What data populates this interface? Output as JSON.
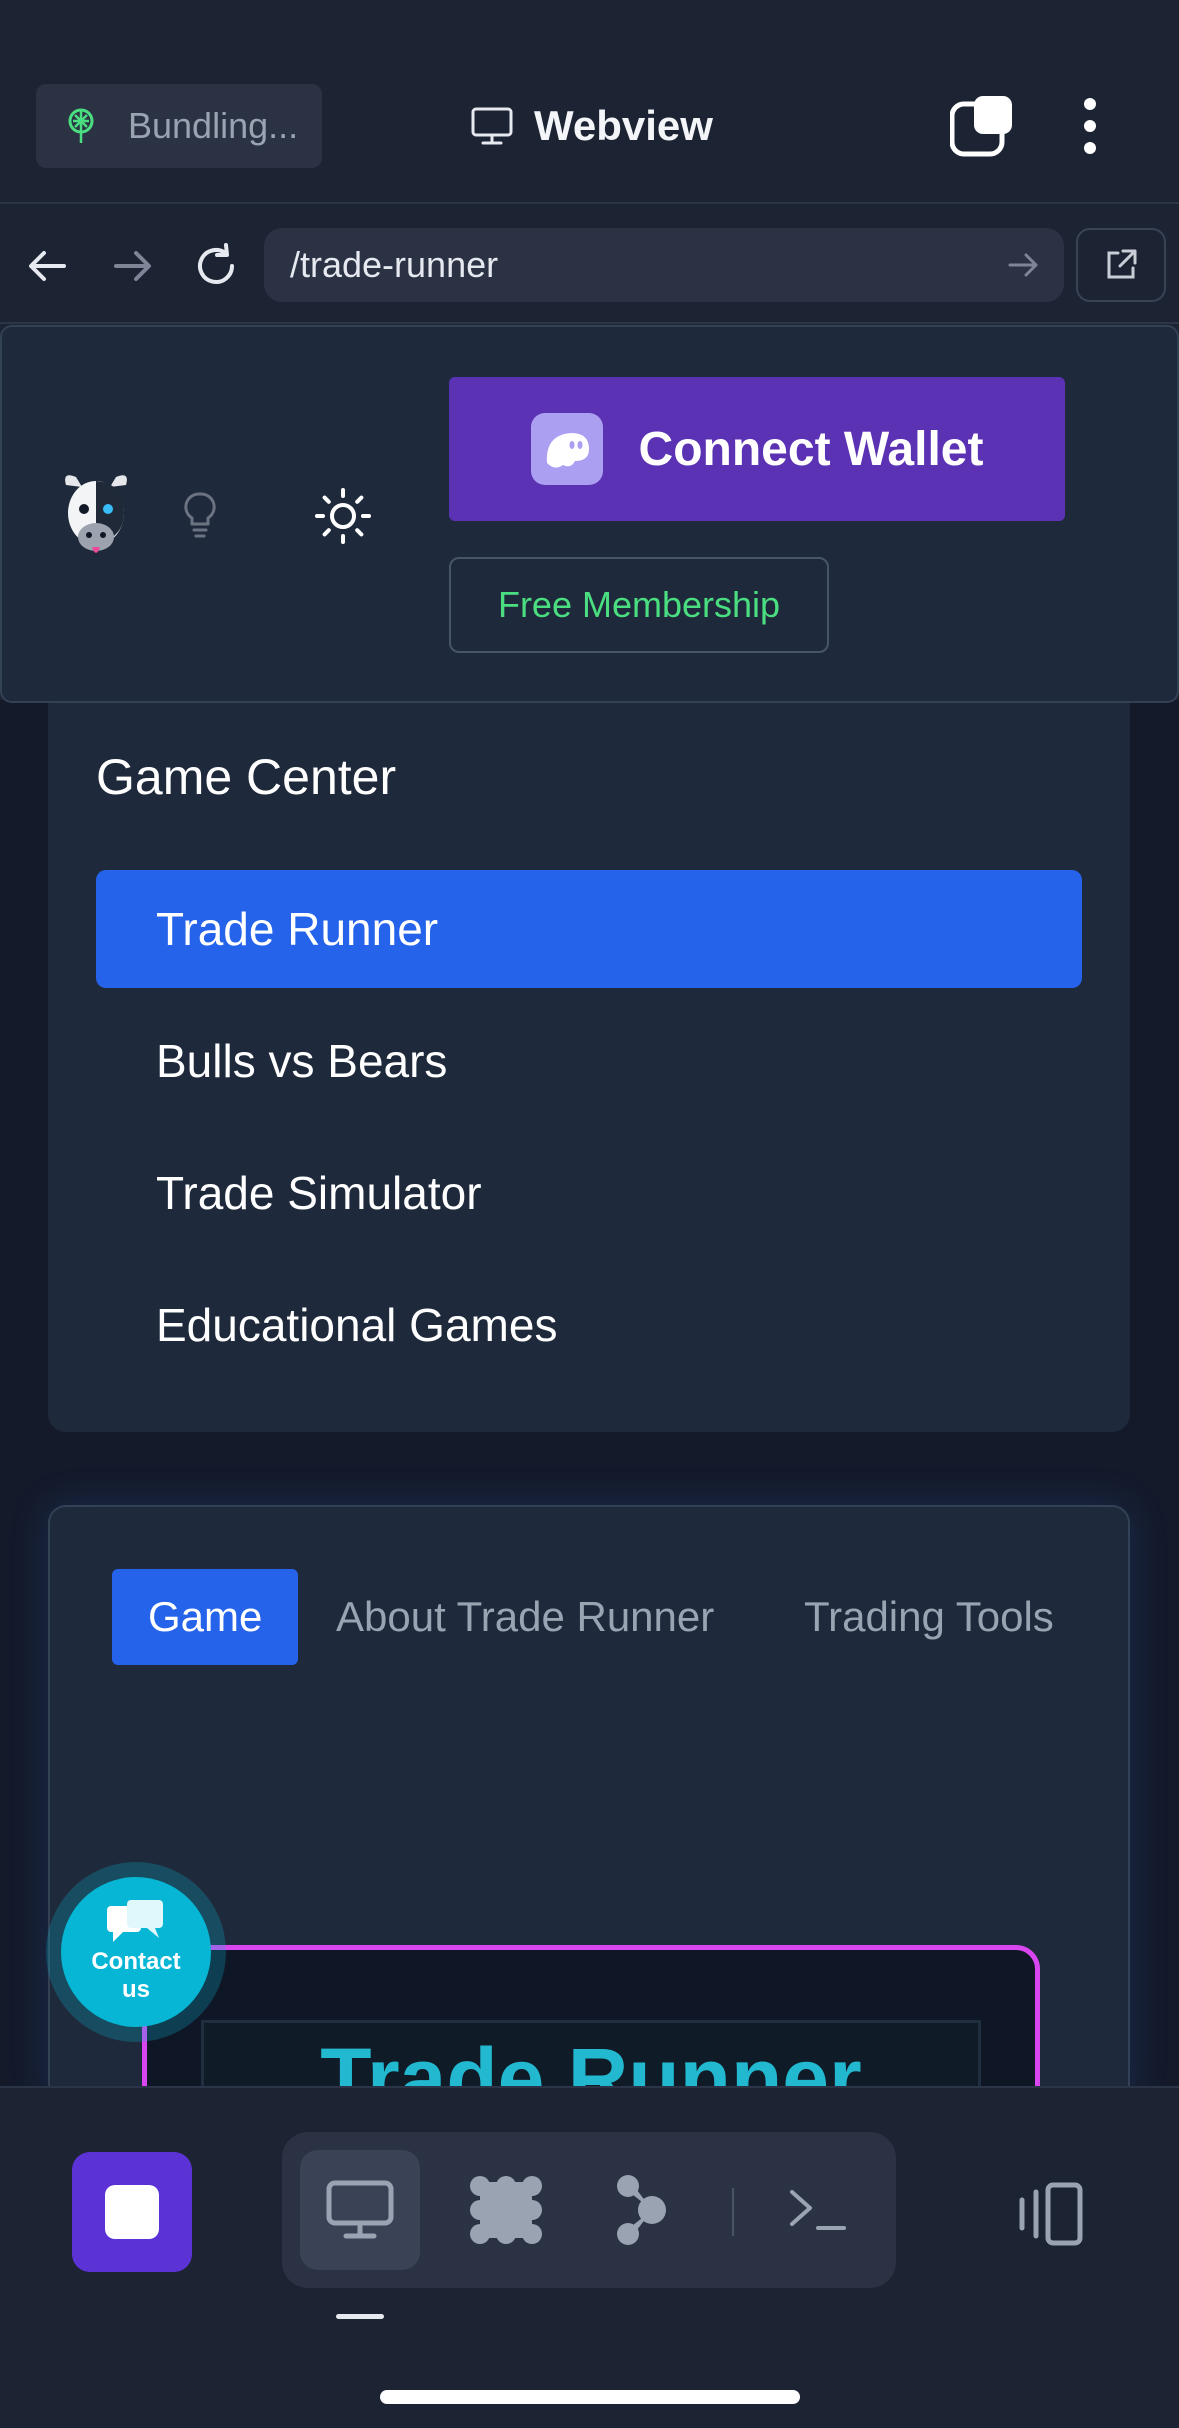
{
  "app_bar": {
    "bundling_label": "Bundling...",
    "title": "Webview",
    "icons": [
      "expo-icon",
      "monitor-icon",
      "tabs-icon",
      "more-vertical-icon"
    ]
  },
  "url_bar": {
    "url": "/trade-runner",
    "icons": [
      "back-icon",
      "forward-icon",
      "reload-icon",
      "go-icon",
      "open-external-icon"
    ]
  },
  "site_header": {
    "connect_wallet_label": "Connect Wallet",
    "membership_label": "Free Membership",
    "colors": {
      "connect": "#5b32b4",
      "membership_text": "#4ade80"
    }
  },
  "game_center": {
    "title": "Game Center",
    "items": [
      {
        "label": "Trade Runner",
        "active": true
      },
      {
        "label": "Bulls vs Bears",
        "active": false
      },
      {
        "label": "Trade Simulator",
        "active": false
      },
      {
        "label": "Educational Games",
        "active": false
      }
    ],
    "active_color": "#2563eb"
  },
  "game_panel": {
    "tabs": [
      {
        "label": "Game",
        "active": true
      },
      {
        "label": "About Trade Runner",
        "active": false
      },
      {
        "label": "Trading Tools",
        "active": false
      }
    ],
    "game_title": "Trade Runner"
  },
  "contact": {
    "line1": "Contact",
    "line2": "us"
  },
  "dev_toolbar": {
    "icons": [
      "stop-icon",
      "preview-icon",
      "cluster-icon",
      "agent-icon",
      "terminal-icon",
      "device-icon"
    ]
  }
}
